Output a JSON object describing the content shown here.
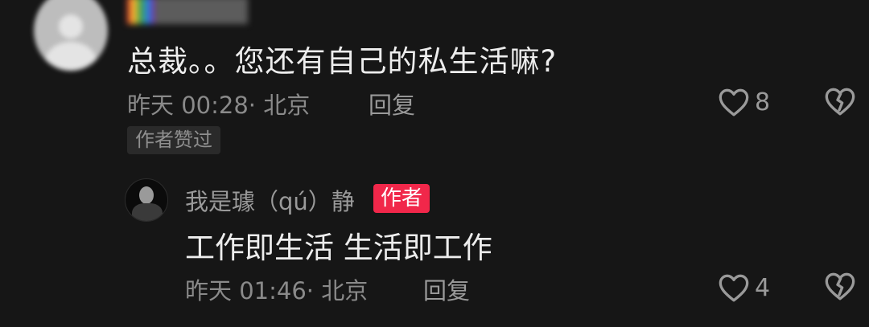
{
  "comment": {
    "text": "总裁。。您还有自己的私生活嘛?",
    "meta": "昨天 00:28· 北京",
    "reply_label": "回复",
    "like_count": "8",
    "author_liked_label": "作者赞过"
  },
  "reply": {
    "author": "我是璩（qú）静",
    "badge": "作者",
    "text": "工作即生活 生活即工作",
    "meta": "昨天 01:46· 北京",
    "reply_label": "回复",
    "like_count": "4"
  },
  "colors": {
    "background": "#161616",
    "badge": "#f1274a"
  },
  "icons": [
    "heart-outline-icon",
    "broken-heart-icon"
  ]
}
